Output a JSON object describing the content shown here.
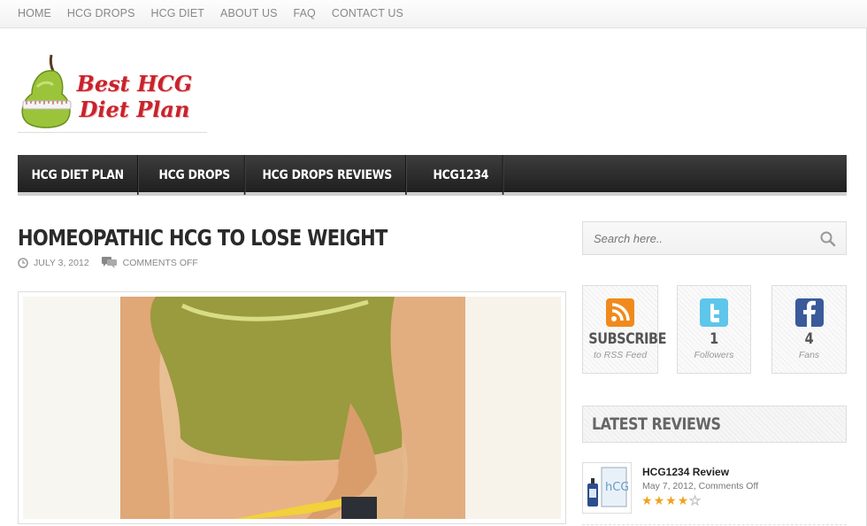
{
  "topnav": [
    "HOME",
    "HCG DROPS",
    "HCG DIET",
    "ABOUT US",
    "FAQ",
    "CONTACT US"
  ],
  "logo": {
    "line1": "Best HCG",
    "line2": "Diet Plan"
  },
  "mainnav": [
    "HCG DIET PLAN",
    "HCG DROPS",
    "HCG DROPS REVIEWS",
    "HCG1234"
  ],
  "post": {
    "title": "HOMEOPATHIC HCG TO LOSE WEIGHT",
    "date": "JULY 3, 2012",
    "comments": "COMMENTS OFF"
  },
  "search": {
    "placeholder": "Search here.."
  },
  "social": [
    {
      "big": "SUBSCRIBE",
      "small": "to RSS Feed",
      "icon": "rss-icon"
    },
    {
      "big": "1",
      "small": "Followers",
      "icon": "twitter-icon"
    },
    {
      "big": "4",
      "small": "Fans",
      "icon": "facebook-icon"
    }
  ],
  "widget": {
    "title": "LATEST REVIEWS"
  },
  "review": {
    "title": "HCG1234 Review",
    "sub": "May 7, 2012, Comments Off",
    "rating": 4,
    "max": 5
  },
  "colors": {
    "accent": "#c8232c",
    "nav_bg": "#2a2a2a",
    "star": "#f2a21c"
  }
}
